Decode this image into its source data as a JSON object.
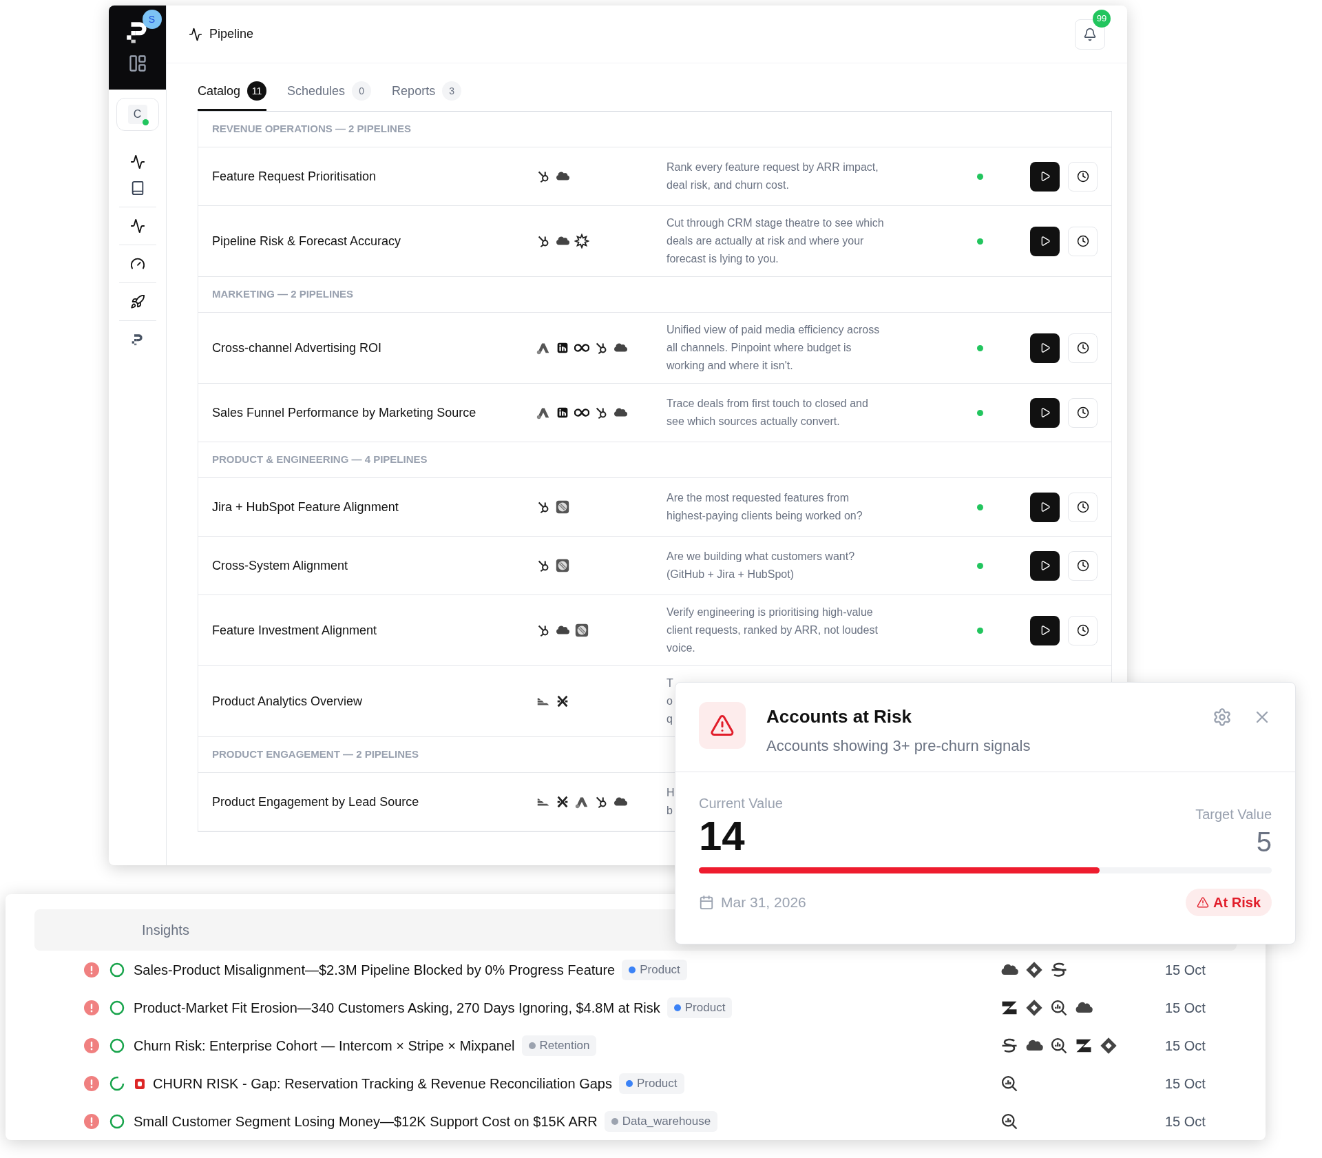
{
  "sidebar": {
    "avatar_badge": "S",
    "workspace": "C",
    "workspace_online": true
  },
  "header": {
    "title": "Pipeline",
    "notifications": "99"
  },
  "tabs": [
    {
      "label": "Catalog",
      "count": "11",
      "selected": true
    },
    {
      "label": "Schedules",
      "count": "0",
      "selected": false
    },
    {
      "label": "Reports",
      "count": "3",
      "selected": false
    }
  ],
  "groups": [
    {
      "title": "REVENUE OPERATIONS — 2 PIPELINES",
      "rows": [
        {
          "name": "Feature Request Prioritisation",
          "sources": [
            {
              "kind": "hub"
            },
            {
              "kind": "cloud"
            }
          ],
          "description": [
            "Rank every feature request by ARR impact,",
            "deal risk, and churn cost."
          ],
          "active": true
        },
        {
          "name": "Pipeline Risk & Forecast Accuracy",
          "sources": [
            {
              "kind": "hub"
            },
            {
              "kind": "cloud"
            },
            {
              "kind": "burst"
            }
          ],
          "description": [
            "Cut through CRM stage theatre to see which",
            "deals are actually at risk and where your",
            "forecast is lying to you."
          ],
          "active": true
        }
      ]
    },
    {
      "title": "MARKETING — 2 PIPELINES",
      "rows": [
        {
          "name": "Cross-channel Advertising ROI",
          "sources": [
            {
              "kind": "peak"
            },
            {
              "kind": "square"
            },
            {
              "kind": "loop"
            },
            {
              "kind": "hub"
            },
            {
              "kind": "cloud"
            }
          ],
          "description": [
            "Unified view of paid media efficiency across",
            "all channels. Pinpoint where budget is",
            "working and where it isn't."
          ],
          "active": true
        },
        {
          "name": "Sales Funnel Performance by Marketing Source",
          "sources": [
            {
              "kind": "peak"
            },
            {
              "kind": "square"
            },
            {
              "kind": "loop"
            },
            {
              "kind": "hub"
            },
            {
              "kind": "cloud"
            }
          ],
          "description": [
            "Trace deals from first touch to closed and",
            "see which sources actually convert."
          ],
          "active": true
        }
      ]
    },
    {
      "title": "PRODUCT & ENGINEERING — 4 PIPELINES",
      "rows": [
        {
          "name": "Jira + HubSpot Feature Alignment",
          "sources": [
            {
              "kind": "hub"
            },
            {
              "kind": "tile"
            }
          ],
          "description": [
            "Are the most requested features from",
            "highest-paying clients being worked on?"
          ],
          "active": true
        },
        {
          "name": "Cross-System Alignment",
          "sources": [
            {
              "kind": "hub"
            },
            {
              "kind": "tile"
            }
          ],
          "description": [
            "Are we building what customers want?",
            "(GitHub + Jira + HubSpot)"
          ],
          "active": true
        },
        {
          "name": "Feature Investment Alignment",
          "sources": [
            {
              "kind": "hub"
            },
            {
              "kind": "cloud"
            },
            {
              "kind": "tile"
            }
          ],
          "description": [
            "Verify engineering is prioritising high-value",
            "client requests, ranked by ARR, not loudest",
            "voice."
          ],
          "active": true
        },
        {
          "name": "Product Analytics Overview",
          "sources": [
            {
              "kind": "bars"
            },
            {
              "kind": "cross"
            }
          ],
          "description": [
            "T",
            "o",
            "q"
          ],
          "active": null
        }
      ]
    },
    {
      "title": "PRODUCT ENGAGEMENT — 2 PIPELINES",
      "rows": [
        {
          "name": "Product Engagement by Lead Source",
          "sources": [
            {
              "kind": "bars"
            },
            {
              "kind": "cross"
            },
            {
              "kind": "peak"
            },
            {
              "kind": "hub"
            },
            {
              "kind": "cloud"
            }
          ],
          "description": [
            "H",
            "b"
          ],
          "active": null
        }
      ]
    }
  ],
  "goal_card": {
    "title": "Accounts at Risk",
    "subtitle": "Accounts showing 3+ pre-churn signals",
    "current_label": "Current Value",
    "current": "14",
    "target_label": "Target Value",
    "target": "5",
    "level": 0.7,
    "date": "Mar 31, 2026",
    "status": "At Risk"
  },
  "insights": {
    "title": "Insights",
    "rows": [
      {
        "title": "Sales-Product Misalignment—$2.3M Pipeline Blocked by 0% Progress Feature",
        "flag": false,
        "tag": {
          "label": "Product",
          "color": "#3b82f6"
        },
        "complete": true,
        "sources": [
          {
            "kind": "cloud"
          },
          {
            "kind": "diamond"
          },
          {
            "kind": "swirl"
          }
        ],
        "date": "15 Oct"
      },
      {
        "title": "Product-Market Fit Erosion—340 Customers Asking, 270 Days Ignoring, $4.8M at Risk",
        "flag": false,
        "tag": {
          "label": "Product",
          "color": "#3b82f6"
        },
        "complete": true,
        "sources": [
          {
            "kind": "zed"
          },
          {
            "kind": "diamond"
          },
          {
            "kind": "lens"
          },
          {
            "kind": "cloud"
          }
        ],
        "date": "15 Oct"
      },
      {
        "title": "Churn Risk: Enterprise Cohort — Intercom × Stripe × Mixpanel",
        "flag": false,
        "tag": {
          "label": "Retention",
          "color": "#9ca3af"
        },
        "complete": true,
        "sources": [
          {
            "kind": "swirl"
          },
          {
            "kind": "cloud"
          },
          {
            "kind": "lens"
          },
          {
            "kind": "zed"
          },
          {
            "kind": "diamond"
          }
        ],
        "date": "15 Oct"
      },
      {
        "title": "CHURN RISK - Gap: Reservation Tracking & Revenue Reconciliation Gaps",
        "flag": true,
        "tag": {
          "label": "Product",
          "color": "#3b82f6"
        },
        "complete": false,
        "sources": [
          {
            "kind": "lens"
          }
        ],
        "date": "15 Oct"
      },
      {
        "title": "Small Customer Segment Losing Money—$12K Support Cost on $15K ARR",
        "flag": false,
        "tag": {
          "label": "Data_warehouse",
          "color": "#9ca3af"
        },
        "complete": true,
        "sources": [
          {
            "kind": "lens"
          }
        ],
        "date": "15 Oct"
      }
    ]
  }
}
